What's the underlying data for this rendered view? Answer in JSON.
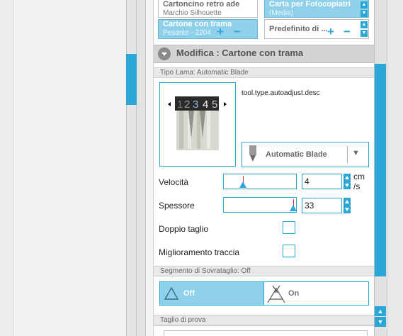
{
  "media": [
    {
      "name": "Cartoncino retro ade",
      "sub": "Marchio Silhouette",
      "selected": false
    },
    {
      "name": "Carta per Fotocopiatri",
      "sub": "(Media)",
      "selected": true
    },
    {
      "name": "Cartone con trama",
      "sub": "Pesante - 2204",
      "selected": true
    },
    {
      "name": "Predefinito di ...",
      "sub": "",
      "selected": false
    }
  ],
  "media_controls": {
    "plus": "+",
    "minus": "−"
  },
  "modify": {
    "title": "Modifica : Cartone con trama"
  },
  "blade": {
    "section": "Tipo Lama: Automatic Blade",
    "desc": "tool.type.autoadjust.desc",
    "dial_digits": [
      "1",
      "2",
      "3",
      "4",
      "5"
    ],
    "select_label": "Automatic Blade",
    "select_arrow": "▼"
  },
  "speed": {
    "label": "Velocità",
    "value": "4",
    "unit": "cm\n/s",
    "level": 0.26
  },
  "thickness": {
    "label": "Spessore",
    "value": "33",
    "level": 0.98
  },
  "double_cut": {
    "label": "Doppio taglio",
    "checked": false
  },
  "line_enhance": {
    "label": "Miglioramento traccia",
    "checked": false
  },
  "overcut": {
    "section": "Segmento di Sovrataglio: Off",
    "off_label": "Off",
    "on_label": "On",
    "value": "Off"
  },
  "test_cut": {
    "section": "Taglio di prova"
  },
  "colors": {
    "accent": "#2aa7d6",
    "selected_fill": "#8fd0ea"
  }
}
